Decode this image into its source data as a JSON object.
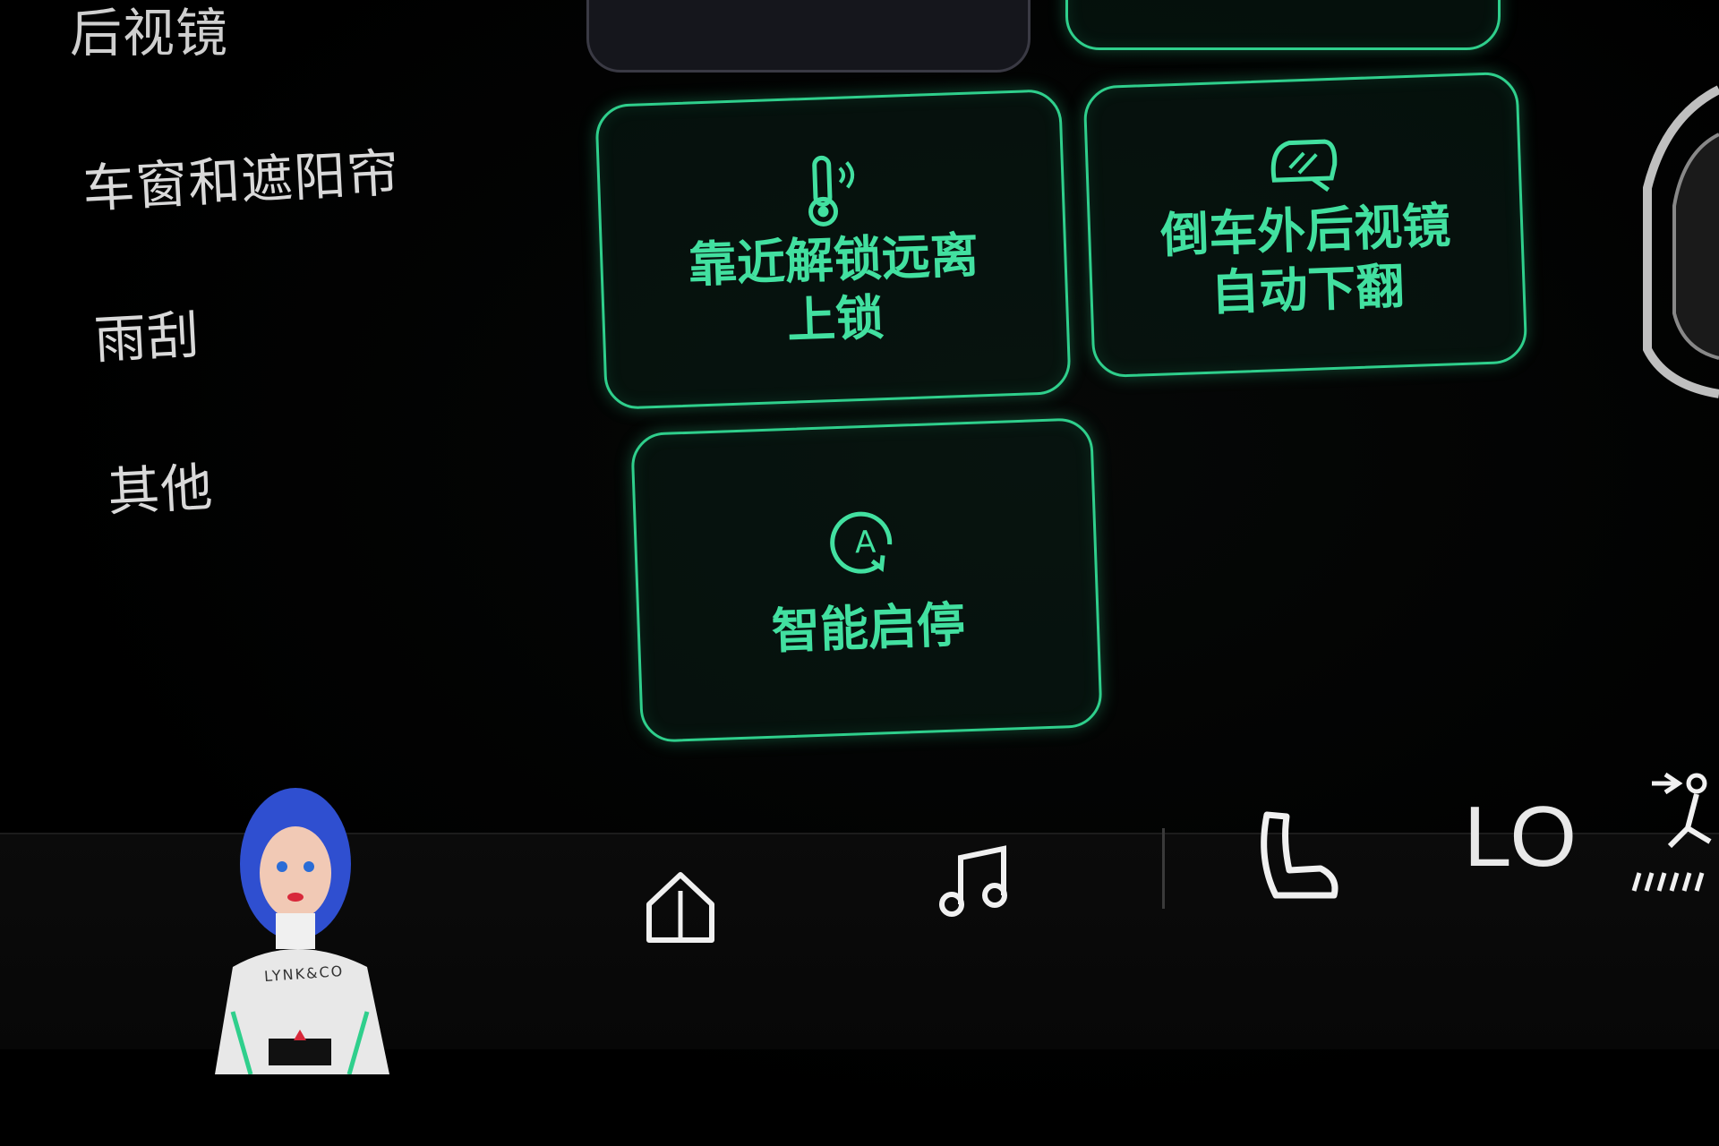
{
  "sidebar": {
    "items": [
      {
        "label": "后视镜"
      },
      {
        "label": "车窗和遮阳帘"
      },
      {
        "label": "雨刮"
      },
      {
        "label": "其他"
      }
    ]
  },
  "tiles": {
    "proximity_lock": {
      "label_line1": "靠近解锁远离",
      "label_line2": "上锁",
      "icon": "thermometer-signal-icon"
    },
    "mirror_tilt": {
      "label_line1": "倒车外后视镜",
      "label_line2": "自动下翻",
      "icon": "mirror-tilt-icon"
    },
    "auto_start_stop": {
      "label": "智能启停",
      "icon": "auto-start-stop-icon"
    }
  },
  "dock": {
    "temperature": "LO",
    "icons": [
      "home-icon",
      "music-icon",
      "seat-icon",
      "fan-airflow-icon"
    ],
    "avatar_badge": "LYNK&CO"
  },
  "colors": {
    "accent": "#2fcf8c",
    "text": "#e6e6e6",
    "background": "#000000"
  }
}
